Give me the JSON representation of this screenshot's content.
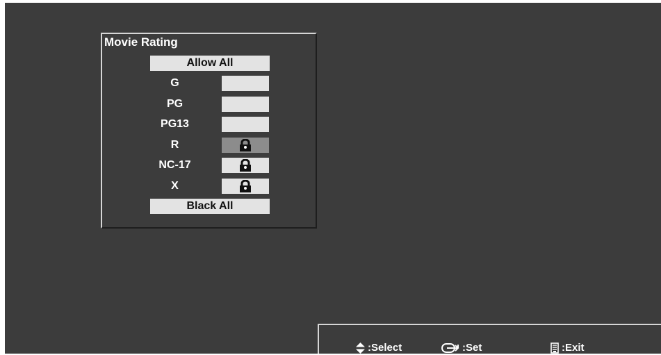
{
  "menu": {
    "title": "Movie Rating",
    "allow_all": "Allow All",
    "block_all": "Black All",
    "ratings": [
      {
        "label": "G",
        "locked": false,
        "selected": false
      },
      {
        "label": "PG",
        "locked": false,
        "selected": false
      },
      {
        "label": "PG13",
        "locked": false,
        "selected": false
      },
      {
        "label": "R",
        "locked": true,
        "selected": true
      },
      {
        "label": "NC-17",
        "locked": true,
        "selected": false
      },
      {
        "label": "X",
        "locked": true,
        "selected": false
      }
    ]
  },
  "footer": {
    "select_label": ":Select",
    "set_label": ":Set",
    "exit_label": ":Exit",
    "select_icon": "up-down-arrows-icon",
    "set_icon": "enter-icon",
    "exit_icon": "remote-exit-icon"
  },
  "colors": {
    "background": "#3c3c3c",
    "button": "#e3e3e3",
    "selected": "#8c8c8c",
    "text": "#ffffff"
  }
}
